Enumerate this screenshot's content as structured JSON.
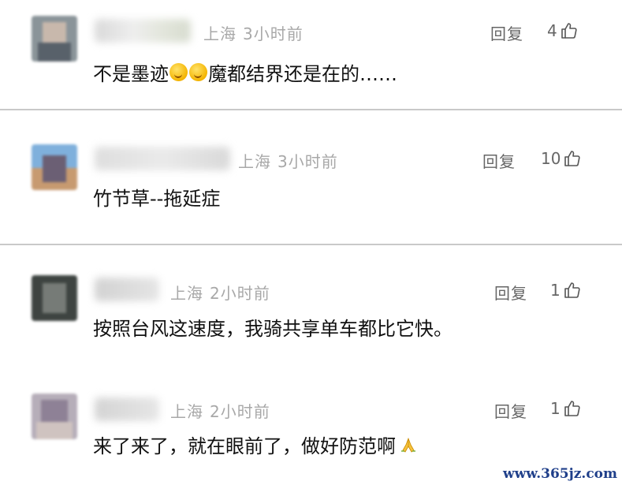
{
  "comments": [
    {
      "location": "上海",
      "time": "3小时前",
      "reply_label": "回复",
      "likes": "4",
      "text_parts": [
        "不是墨迹",
        "魔都结界还是在的……"
      ],
      "emoji": "fingers-crossed-face-emoji"
    },
    {
      "location": "上海",
      "time": "3小时前",
      "reply_label": "回复",
      "likes": "10",
      "text": "竹节草--拖延症"
    },
    {
      "location": "上海",
      "time": "2小时前",
      "reply_label": "回复",
      "likes": "1",
      "text": "按照台风这速度，我骑共享单车都比它快。"
    },
    {
      "location": "上海",
      "time": "2小时前",
      "reply_label": "回复",
      "likes": "1",
      "text": "来了来了，就在眼前了，做好防范啊",
      "emoji": "folded-hands-emoji"
    }
  ],
  "icons": {
    "like": "thumbs-up-icon"
  },
  "watermark": "www.365jz.com",
  "colors": {
    "meta": "#a8a8a8",
    "action": "#666666",
    "divider": "#c9c9c9",
    "watermark": "#1f3f8a"
  }
}
